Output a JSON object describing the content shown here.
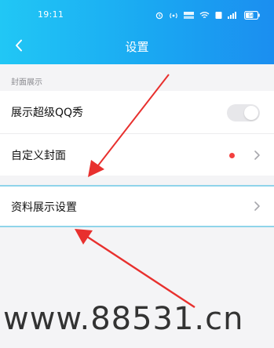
{
  "status_bar": {
    "time": "19:11",
    "battery": "56",
    "icons": [
      "alarm-icon",
      "hotspot-icon",
      "network-speed-icon",
      "wifi-icon",
      "sim-icon",
      "cellular-signal-icon",
      "battery-icon"
    ]
  },
  "nav": {
    "title": "设置",
    "back_icon": "chevron-left-icon"
  },
  "section": {
    "label": "封面展示"
  },
  "rows": [
    {
      "label": "展示超级QQ秀",
      "control": "toggle",
      "toggle_on": false
    },
    {
      "label": "自定义封面",
      "control": "chevron",
      "has_red_dot": true
    }
  ],
  "highlight_row": {
    "label": "资料展示设置",
    "control": "chevron"
  },
  "watermark": "www.88531.cn",
  "colors": {
    "header_start": "#21c7f5",
    "header_end": "#1b8ef0",
    "arrow": "#e8302e",
    "red_dot": "#f3403f",
    "highlight_border": "#8fd4ea"
  }
}
